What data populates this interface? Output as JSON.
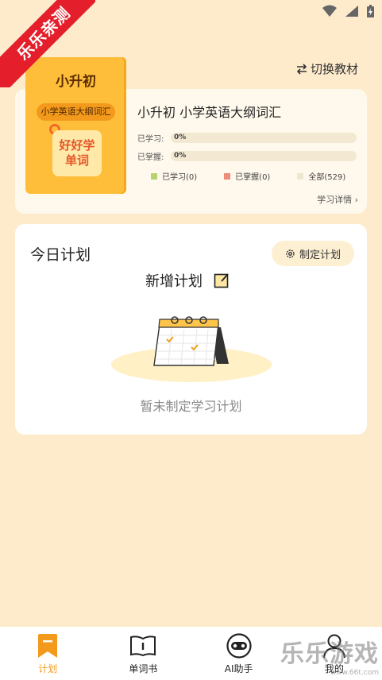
{
  "watermark": {
    "ribbon": "乐乐亲测",
    "site_name": "乐乐游戏",
    "site_url": "www.66t.com"
  },
  "header": {
    "switch_label": "切换教材"
  },
  "book": {
    "cover_title": "小升初",
    "cover_pill": "小学英语大纲词汇",
    "cover_badge_line1": "好好学",
    "cover_badge_line2": "单词",
    "name": "小升初 小学英语大纲词汇",
    "learned_label": "已学习:",
    "learned_pct": "0%",
    "mastered_label": "已掌握:",
    "mastered_pct": "0%",
    "legend": [
      {
        "label": "已学习(0)",
        "color": "#B6D36E"
      },
      {
        "label": "已掌握(0)",
        "color": "#EE8C7A"
      },
      {
        "label": "全部(529)",
        "color": "#EEE6CF"
      }
    ],
    "detail_link": "学习详情 ›"
  },
  "plan": {
    "title": "今日计划",
    "make_plan_label": "制定计划",
    "add_plan_label": "新增计划",
    "empty_text": "暂未制定学习计划"
  },
  "nav": [
    {
      "label": "计划",
      "icon": "bookmark-icon"
    },
    {
      "label": "单词书",
      "icon": "open-book-icon"
    },
    {
      "label": "AI助手",
      "icon": "robot-icon"
    },
    {
      "label": "我的",
      "icon": "user-icon"
    }
  ],
  "colors": {
    "accent": "#F39A1C",
    "background": "#FDEBCB"
  }
}
